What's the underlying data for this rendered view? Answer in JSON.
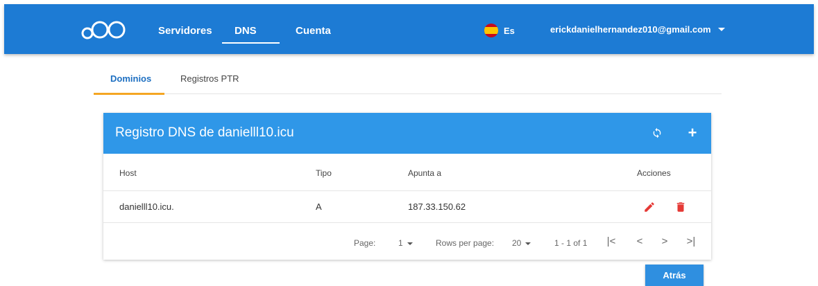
{
  "colors": {
    "topbar": "#1d7bd4",
    "card_header": "#2f97e8",
    "tab_active": "#f5a623",
    "delete": "#e53935",
    "edit": "#e53935"
  },
  "nav": {
    "logo_icon": "cloud-circles-logo-icon",
    "items": [
      {
        "label": "Servidores"
      },
      {
        "label": "DNS",
        "active": true
      },
      {
        "label": "Cuenta"
      }
    ],
    "language": {
      "flag_icon": "spain-flag-icon",
      "code": "Es"
    },
    "user_email": "erickdanielhernandez010@gmail.com"
  },
  "tabs": [
    {
      "label": "Dominios",
      "active": true
    },
    {
      "label": "Registros PTR"
    }
  ],
  "card": {
    "title": "Registro DNS de danielll10.icu",
    "refresh_icon": "refresh-icon",
    "add_label": "+",
    "columns": {
      "host": "Host",
      "tipo": "Tipo",
      "apunta": "Apunta a",
      "acciones": "Acciones"
    },
    "rows": [
      {
        "host": "danielll10.icu.",
        "tipo": "A",
        "apunta": "187.33.150.62"
      }
    ],
    "pagination": {
      "page_label": "Page:",
      "page_value": "1",
      "rows_label": "Rows per page:",
      "rows_value": "20",
      "range": "1 - 1 of 1",
      "first": "|<",
      "prev": "<",
      "next": ">",
      "last": ">|"
    }
  },
  "back_button": "Atrás"
}
